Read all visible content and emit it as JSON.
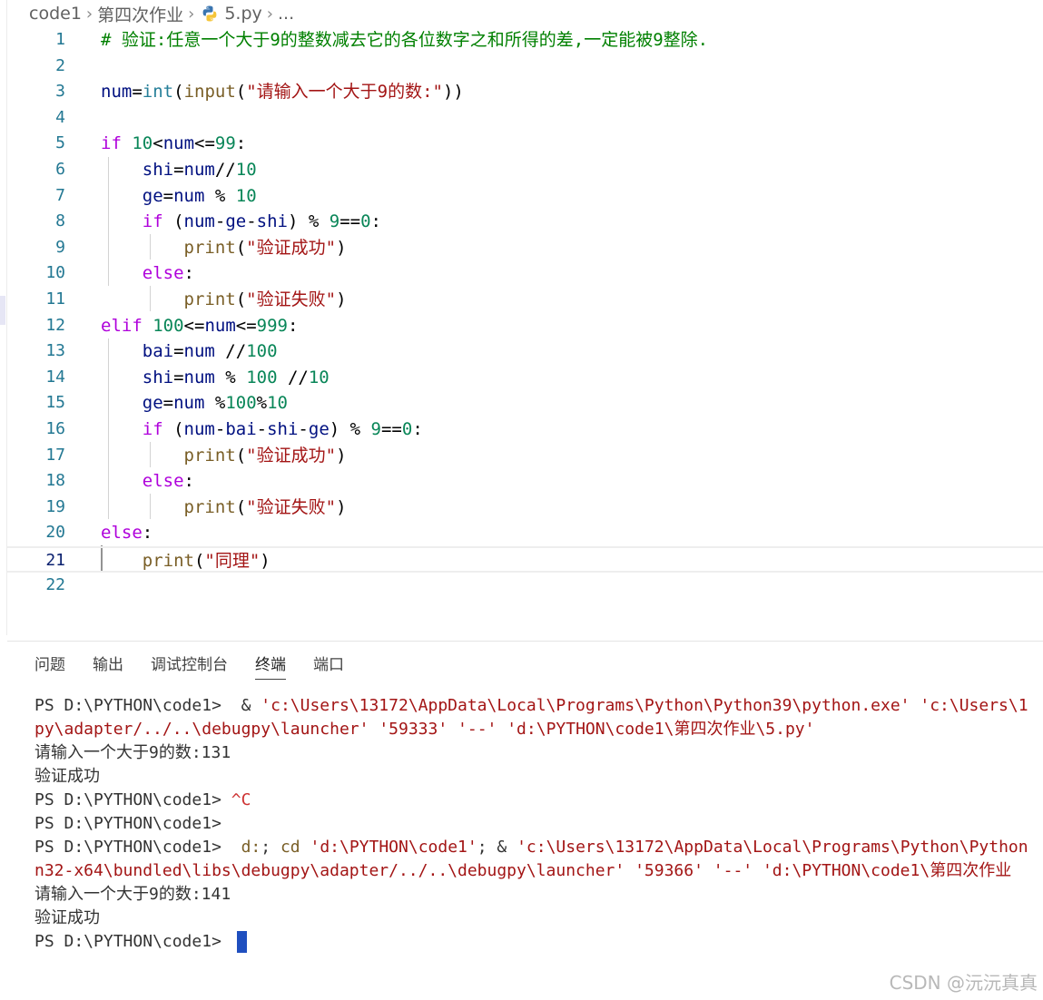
{
  "breadcrumb": {
    "items": [
      "code1",
      "第四次作业",
      "5.py",
      "..."
    ],
    "icon": "python-icon"
  },
  "editor": {
    "active_line": 21,
    "lines": [
      {
        "n": "1",
        "tokens": [
          {
            "t": "# 验证:任意一个大于9的整数减去它的各位数字之和所得的差,一定能被9整除.",
            "c": "cmt"
          }
        ]
      },
      {
        "n": "2",
        "tokens": []
      },
      {
        "n": "3",
        "tokens": [
          {
            "t": "num",
            "c": "var"
          },
          {
            "t": "=",
            "c": "op"
          },
          {
            "t": "int",
            "c": "bi"
          },
          {
            "t": "(",
            "c": "op"
          },
          {
            "t": "input",
            "c": "fn"
          },
          {
            "t": "(",
            "c": "op"
          },
          {
            "t": "\"请输入一个大于9的数:\"",
            "c": "str"
          },
          {
            "t": "))",
            "c": "op"
          }
        ]
      },
      {
        "n": "4",
        "tokens": []
      },
      {
        "n": "5",
        "tokens": [
          {
            "t": "if",
            "c": "kw"
          },
          {
            "t": " ",
            "c": "op"
          },
          {
            "t": "10",
            "c": "num"
          },
          {
            "t": "<",
            "c": "op"
          },
          {
            "t": "num",
            "c": "var"
          },
          {
            "t": "<=",
            "c": "op"
          },
          {
            "t": "99",
            "c": "num"
          },
          {
            "t": ":",
            "c": "op"
          }
        ]
      },
      {
        "n": "6",
        "tokens": [
          {
            "t": "    shi",
            "c": "var"
          },
          {
            "t": "=",
            "c": "op"
          },
          {
            "t": "num",
            "c": "var"
          },
          {
            "t": "//",
            "c": "op"
          },
          {
            "t": "10",
            "c": "num"
          }
        ]
      },
      {
        "n": "7",
        "tokens": [
          {
            "t": "    ge",
            "c": "var"
          },
          {
            "t": "=",
            "c": "op"
          },
          {
            "t": "num",
            "c": "var"
          },
          {
            "t": " % ",
            "c": "op"
          },
          {
            "t": "10",
            "c": "num"
          }
        ]
      },
      {
        "n": "8",
        "tokens": [
          {
            "t": "    if",
            "c": "kw"
          },
          {
            "t": " (",
            "c": "op"
          },
          {
            "t": "num",
            "c": "var"
          },
          {
            "t": "-",
            "c": "op"
          },
          {
            "t": "ge",
            "c": "var"
          },
          {
            "t": "-",
            "c": "op"
          },
          {
            "t": "shi",
            "c": "var"
          },
          {
            "t": ") % ",
            "c": "op"
          },
          {
            "t": "9",
            "c": "num"
          },
          {
            "t": "==",
            "c": "op"
          },
          {
            "t": "0",
            "c": "num"
          },
          {
            "t": ":",
            "c": "op"
          }
        ]
      },
      {
        "n": "9",
        "tokens": [
          {
            "t": "        print",
            "c": "fn"
          },
          {
            "t": "(",
            "c": "op"
          },
          {
            "t": "\"验证成功\"",
            "c": "str"
          },
          {
            "t": ")",
            "c": "op"
          }
        ]
      },
      {
        "n": "10",
        "tokens": [
          {
            "t": "    else",
            "c": "kw"
          },
          {
            "t": ":",
            "c": "op"
          }
        ]
      },
      {
        "n": "11",
        "tokens": [
          {
            "t": "        print",
            "c": "fn"
          },
          {
            "t": "(",
            "c": "op"
          },
          {
            "t": "\"验证失败\"",
            "c": "str"
          },
          {
            "t": ")",
            "c": "op"
          }
        ]
      },
      {
        "n": "12",
        "tokens": [
          {
            "t": "elif",
            "c": "kw"
          },
          {
            "t": " ",
            "c": "op"
          },
          {
            "t": "100",
            "c": "num"
          },
          {
            "t": "<=",
            "c": "op"
          },
          {
            "t": "num",
            "c": "var"
          },
          {
            "t": "<=",
            "c": "op"
          },
          {
            "t": "999",
            "c": "num"
          },
          {
            "t": ":",
            "c": "op"
          }
        ]
      },
      {
        "n": "13",
        "tokens": [
          {
            "t": "    bai",
            "c": "var"
          },
          {
            "t": "=",
            "c": "op"
          },
          {
            "t": "num",
            "c": "var"
          },
          {
            "t": " //",
            "c": "op"
          },
          {
            "t": "100",
            "c": "num"
          }
        ]
      },
      {
        "n": "14",
        "tokens": [
          {
            "t": "    shi",
            "c": "var"
          },
          {
            "t": "=",
            "c": "op"
          },
          {
            "t": "num",
            "c": "var"
          },
          {
            "t": " % ",
            "c": "op"
          },
          {
            "t": "100",
            "c": "num"
          },
          {
            "t": " //",
            "c": "op"
          },
          {
            "t": "10",
            "c": "num"
          }
        ]
      },
      {
        "n": "15",
        "tokens": [
          {
            "t": "    ge",
            "c": "var"
          },
          {
            "t": "=",
            "c": "op"
          },
          {
            "t": "num",
            "c": "var"
          },
          {
            "t": " %",
            "c": "op"
          },
          {
            "t": "100",
            "c": "num"
          },
          {
            "t": "%",
            "c": "op"
          },
          {
            "t": "10",
            "c": "num"
          }
        ]
      },
      {
        "n": "16",
        "tokens": [
          {
            "t": "    if",
            "c": "kw"
          },
          {
            "t": " (",
            "c": "op"
          },
          {
            "t": "num",
            "c": "var"
          },
          {
            "t": "-",
            "c": "op"
          },
          {
            "t": "bai",
            "c": "var"
          },
          {
            "t": "-",
            "c": "op"
          },
          {
            "t": "shi",
            "c": "var"
          },
          {
            "t": "-",
            "c": "op"
          },
          {
            "t": "ge",
            "c": "var"
          },
          {
            "t": ") % ",
            "c": "op"
          },
          {
            "t": "9",
            "c": "num"
          },
          {
            "t": "==",
            "c": "op"
          },
          {
            "t": "0",
            "c": "num"
          },
          {
            "t": ":",
            "c": "op"
          }
        ]
      },
      {
        "n": "17",
        "tokens": [
          {
            "t": "        print",
            "c": "fn"
          },
          {
            "t": "(",
            "c": "op"
          },
          {
            "t": "\"验证成功\"",
            "c": "str"
          },
          {
            "t": ")",
            "c": "op"
          }
        ]
      },
      {
        "n": "18",
        "tokens": [
          {
            "t": "    else",
            "c": "kw"
          },
          {
            "t": ":",
            "c": "op"
          }
        ]
      },
      {
        "n": "19",
        "tokens": [
          {
            "t": "        print",
            "c": "fn"
          },
          {
            "t": "(",
            "c": "op"
          },
          {
            "t": "\"验证失败\"",
            "c": "str"
          },
          {
            "t": ")",
            "c": "op"
          }
        ]
      },
      {
        "n": "20",
        "tokens": [
          {
            "t": "else",
            "c": "kw"
          },
          {
            "t": ":",
            "c": "op"
          }
        ]
      },
      {
        "n": "21",
        "tokens": [
          {
            "t": "    print",
            "c": "fn"
          },
          {
            "t": "(",
            "c": "op"
          },
          {
            "t": "\"同理\"",
            "c": "str"
          },
          {
            "t": ")",
            "c": "op"
          }
        ]
      },
      {
        "n": "22",
        "tokens": []
      }
    ]
  },
  "panel": {
    "tabs": [
      {
        "label": "问题",
        "active": false
      },
      {
        "label": "输出",
        "active": false
      },
      {
        "label": "调试控制台",
        "active": false
      },
      {
        "label": "终端",
        "active": true
      },
      {
        "label": "端口",
        "active": false
      }
    ],
    "terminal": [
      [
        {
          "t": "PS D:\\PYTHON\\code1>  ",
          "c": "txt"
        },
        {
          "t": "& ",
          "c": "txt"
        },
        {
          "t": "'c:\\Users\\13172\\AppData\\Local\\Programs\\Python\\Python39\\python.exe'",
          "c": "str"
        },
        {
          "t": " ",
          "c": "txt"
        },
        {
          "t": "'c:\\Users\\1",
          "c": "str"
        }
      ],
      [
        {
          "t": "py\\adapter/../..\\debugpy\\launcher'",
          "c": "str"
        },
        {
          "t": " ",
          "c": "txt"
        },
        {
          "t": "'59333'",
          "c": "str"
        },
        {
          "t": " ",
          "c": "txt"
        },
        {
          "t": "'--'",
          "c": "str"
        },
        {
          "t": " ",
          "c": "txt"
        },
        {
          "t": "'d:\\PYTHON\\code1\\第四次作业\\5.py'",
          "c": "str"
        }
      ],
      [
        {
          "t": "请输入一个大于9的数:131",
          "c": "txt"
        }
      ],
      [
        {
          "t": "验证成功",
          "c": "txt"
        }
      ],
      [
        {
          "t": "PS D:\\PYTHON\\code1> ",
          "c": "txt"
        },
        {
          "t": "^C",
          "c": "ctrl"
        }
      ],
      [
        {
          "t": "PS D:\\PYTHON\\code1>",
          "c": "txt"
        }
      ],
      [
        {
          "t": "PS D:\\PYTHON\\code1>  ",
          "c": "txt"
        },
        {
          "t": "d:",
          "c": "cmd"
        },
        {
          "t": "; ",
          "c": "txt"
        },
        {
          "t": "cd",
          "c": "cmd"
        },
        {
          "t": " ",
          "c": "txt"
        },
        {
          "t": "'d:\\PYTHON\\code1'",
          "c": "str"
        },
        {
          "t": "; & ",
          "c": "txt"
        },
        {
          "t": "'c:\\Users\\13172\\AppData\\Local\\Programs\\Python\\Python",
          "c": "str"
        }
      ],
      [
        {
          "t": "n32-x64\\bundled\\libs\\debugpy\\adapter/../..\\debugpy\\launcher'",
          "c": "str"
        },
        {
          "t": " ",
          "c": "txt"
        },
        {
          "t": "'59366'",
          "c": "str"
        },
        {
          "t": " ",
          "c": "txt"
        },
        {
          "t": "'--'",
          "c": "str"
        },
        {
          "t": " ",
          "c": "txt"
        },
        {
          "t": "'d:\\PYTHON\\code1\\第四次作业",
          "c": "str"
        }
      ],
      [
        {
          "t": "请输入一个大于9的数:141",
          "c": "txt"
        }
      ],
      [
        {
          "t": "验证成功",
          "c": "txt"
        }
      ],
      [
        {
          "t": "PS D:\\PYTHON\\code1> ",
          "c": "txt"
        }
      ]
    ]
  },
  "watermark": "CSDN @沅沅真真",
  "colors": {
    "line_number": "#237893",
    "keyword": "#af00db",
    "string": "#a31515",
    "number": "#098658",
    "variable": "#001080",
    "function": "#795e26",
    "builtin": "#267f99",
    "comment": "#008000",
    "cursor": "#1f4fbf"
  }
}
